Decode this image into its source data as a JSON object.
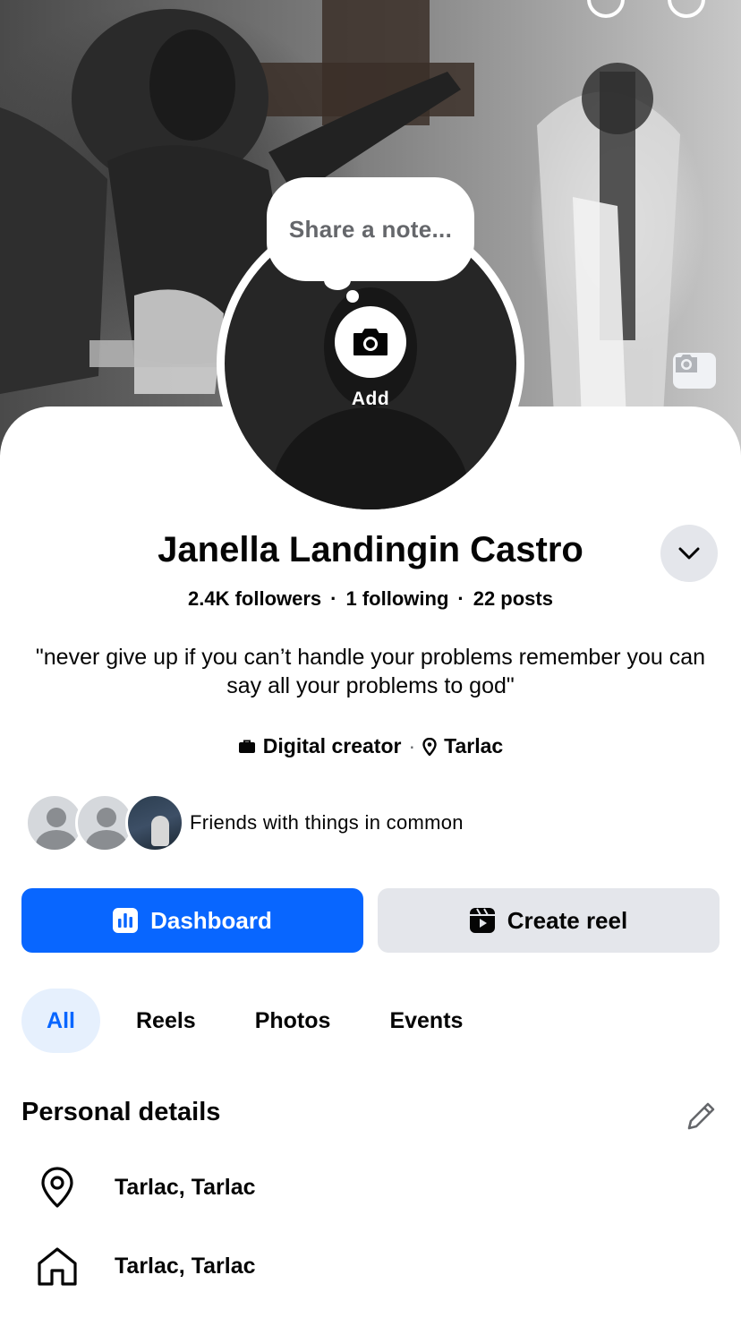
{
  "note": {
    "placeholder": "Share a note..."
  },
  "avatar": {
    "add_label": "Add"
  },
  "profile": {
    "name": "Janella Landingin Castro",
    "followers": "2.4K followers",
    "following": "1 following",
    "posts": "22 posts",
    "bio": "\"never give up if you can’t handle your problems remember you can say all your problems to god\"",
    "category": "Digital creator",
    "location": "Tarlac"
  },
  "friends": {
    "text": "Friends with things in common"
  },
  "actions": {
    "dashboard_label": "Dashboard",
    "create_reel_label": "Create reel"
  },
  "tabs": [
    {
      "label": "All",
      "active": true
    },
    {
      "label": "Reels",
      "active": false
    },
    {
      "label": "Photos",
      "active": false
    },
    {
      "label": "Events",
      "active": false
    }
  ],
  "personal_details": {
    "title": "Personal details",
    "items": [
      {
        "icon": "location-pin-icon",
        "text": "Tarlac, Tarlac"
      },
      {
        "icon": "home-icon",
        "text": "Tarlac, Tarlac"
      }
    ]
  },
  "colors": {
    "primary": "#0866ff",
    "primary_tint": "#e6f0fd",
    "secondary_button": "#e4e6eb",
    "text": "#050505",
    "muted": "#65676b"
  }
}
